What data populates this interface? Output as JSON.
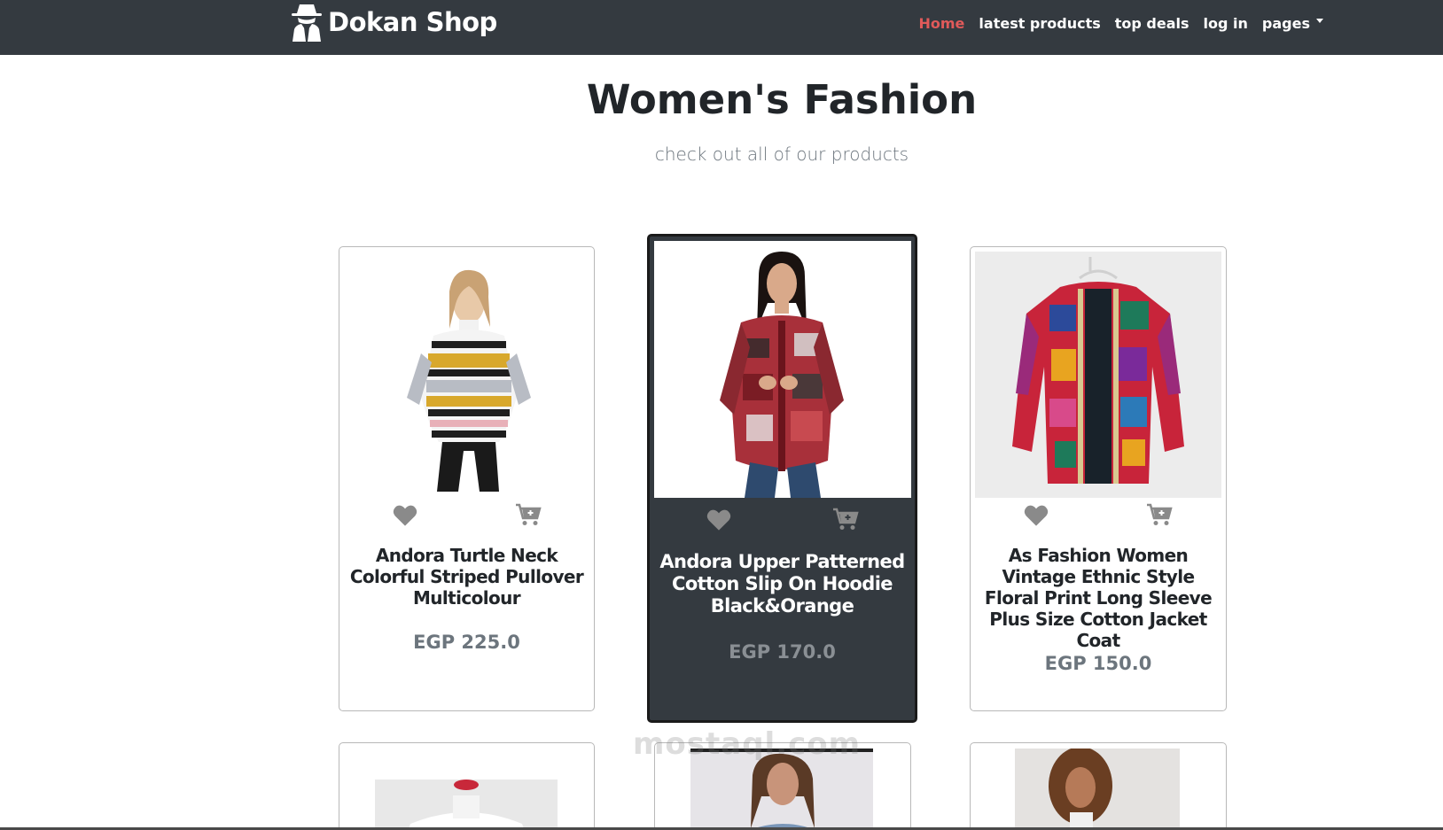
{
  "brand": {
    "name": "Dokan Shop",
    "icon": "spy-icon"
  },
  "nav": {
    "items": [
      {
        "label": "Home",
        "active": true
      },
      {
        "label": "latest products"
      },
      {
        "label": "top deals"
      },
      {
        "label": "log in"
      },
      {
        "label": "pages",
        "dropdown": true
      }
    ]
  },
  "page": {
    "title": "Women's Fashion",
    "subtitle": "check out all of our products"
  },
  "products": [
    {
      "name": "Andora Turtle Neck Colorful Striped Pullover Multicolour",
      "price": "EGP 225.0"
    },
    {
      "name": "Andora Upper Patterned Cotton Slip On Hoodie Black&Orange",
      "price": "EGP 170.0"
    },
    {
      "name": "As Fashion Women Vintage Ethnic Style Floral Print Long Sleeve Plus Size Cotton Jacket Coat",
      "price": "EGP 150.0"
    }
  ],
  "watermark": "mostaql.com",
  "colors": {
    "navbar": "#343a40",
    "active_link": "#e05a5a",
    "price": "#6c757d",
    "icon": "#8a8a8a"
  }
}
